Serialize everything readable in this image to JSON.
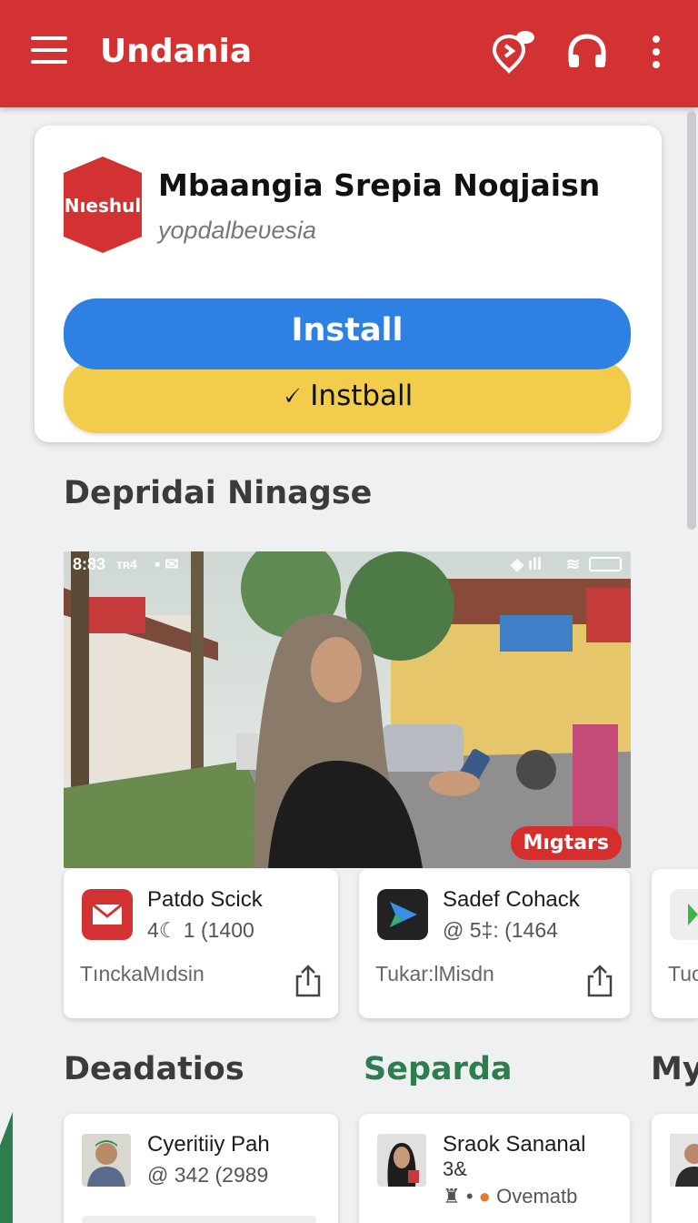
{
  "appbar": {
    "title": "Undania",
    "icons": [
      "menu-icon",
      "location-chat-icon",
      "headphones-icon",
      "more-vert-icon"
    ]
  },
  "install_card": {
    "logo_text": "Nıeshul",
    "app_name": "Mbaangia Srepia Noqjaisn",
    "developer": "yopdalbeυesia",
    "install_label": "Install",
    "secondary_label": "🗸 Instball"
  },
  "section1": {
    "title": "Depridai Ninagse"
  },
  "feature": {
    "status_time": "8:83",
    "status_mid": "ᴛʀ4",
    "badge": "Mıgtars"
  },
  "apps": [
    {
      "name": "Patdo Scick",
      "meta": "4☾  1 (1400",
      "footer": "TınckaMıdsin",
      "icon": "mail-icon",
      "icon_color": "#d23232"
    },
    {
      "name": "Sadef Cohack",
      "meta": "@ 5‡: (1464",
      "footer": "Tukar:lMisdn",
      "icon": "send-icon",
      "icon_color": "#222222"
    },
    {
      "name": "",
      "meta": "",
      "footer": "Tuo",
      "icon": "play-icon",
      "icon_color": "#eeeeee"
    }
  ],
  "tabs": {
    "first": "Deadatios",
    "second": "Separda",
    "third": "My"
  },
  "people": [
    {
      "name": "Cyeritiiy Pah",
      "meta": "@ 342 (2989"
    },
    {
      "name": "Sraok Sananal",
      "meta": "3&",
      "meta2": "Ovematb"
    }
  ],
  "colors": {
    "brand_red": "#d23232",
    "install_blue": "#2f80e3",
    "secondary_yellow": "#f1cd4b",
    "tab_green": "#2e7d4f"
  }
}
